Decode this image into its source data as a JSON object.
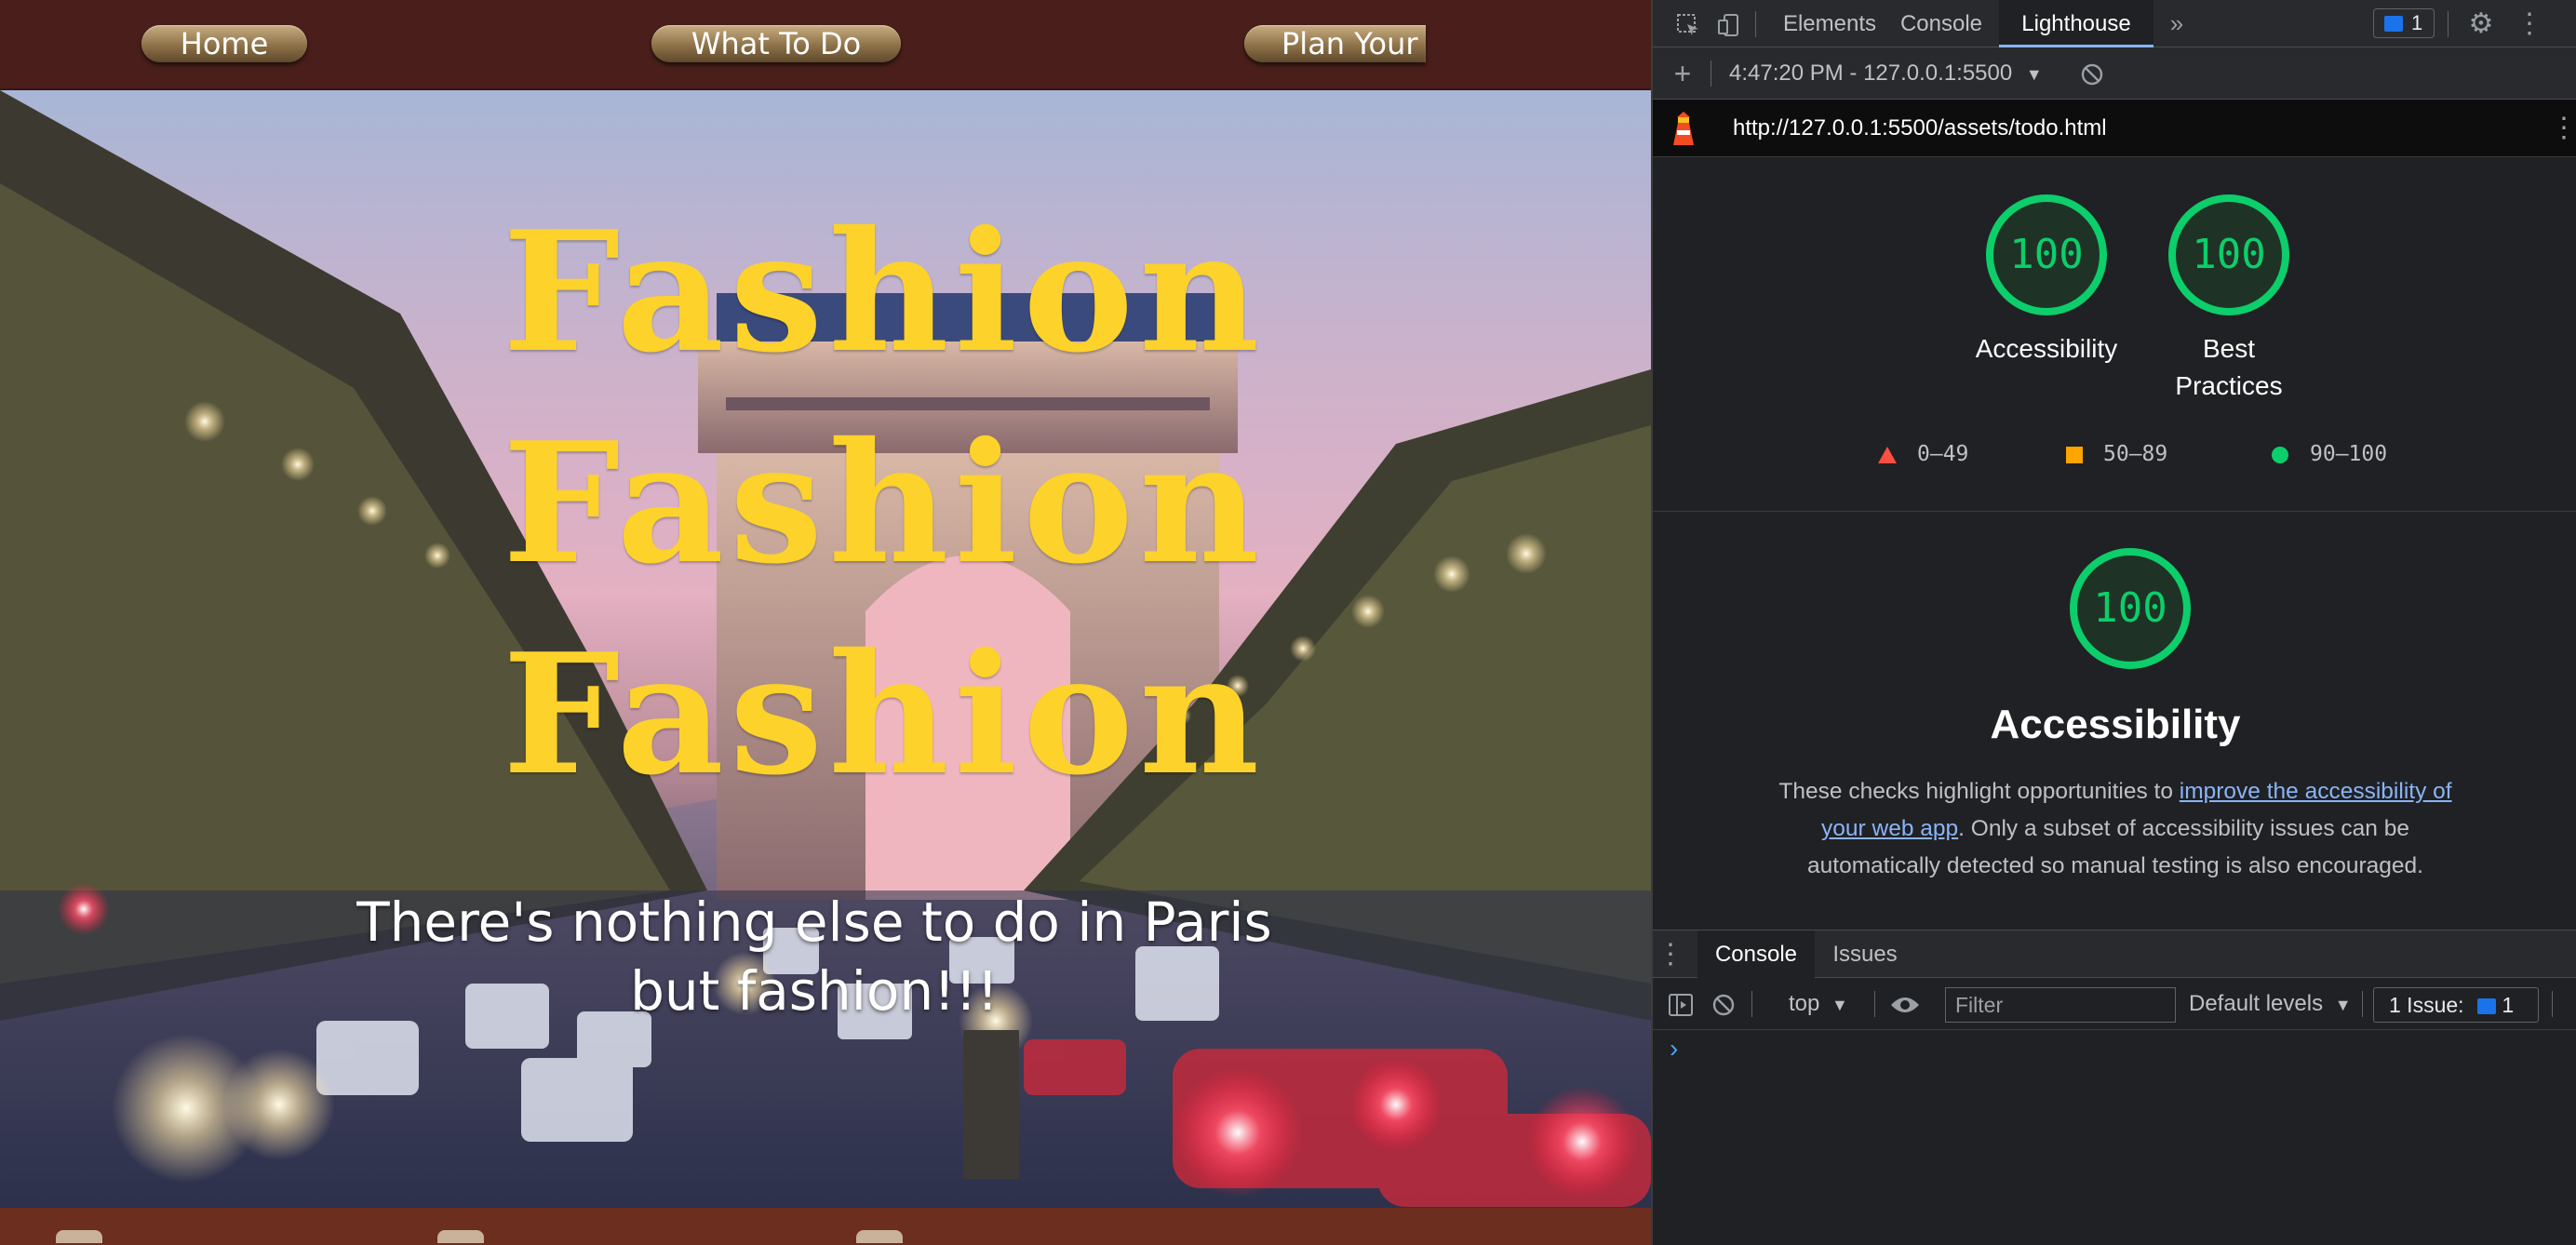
{
  "site": {
    "nav": {
      "home": "Home",
      "what_to_do": "What To Do",
      "plan": "Plan Your"
    },
    "hero": {
      "title_lines": [
        "Fashion",
        "Fashion",
        "Fashion"
      ],
      "tagline": "There's nothing else to do in Paris but fashion!!!"
    }
  },
  "devtools": {
    "tabs": {
      "elements": "Elements",
      "console": "Console",
      "lighthouse": "Lighthouse"
    },
    "issues_count": "1",
    "report_selector": "4:47:20 PM - 127.0.0.1:5500",
    "url": "http://127.0.0.1:5500/assets/todo.html",
    "scores": [
      {
        "value": "100",
        "label": "Accessibility"
      },
      {
        "value": "100",
        "label": "Best Practices"
      }
    ],
    "legend": [
      {
        "range": "0–49",
        "color": "#ff4e42"
      },
      {
        "range": "50–89",
        "color": "#ffa400"
      },
      {
        "range": "90–100",
        "color": "#0cce6b"
      }
    ],
    "category": {
      "score": "100",
      "title": "Accessibility",
      "desc_before": "These checks highlight opportunities to ",
      "desc_link": "improve the accessibility of your web app",
      "desc_after": ". Only a subset of accessibility issues can be automatically detected so manual testing is also encouraged."
    },
    "drawer": {
      "tabs": {
        "console": "Console",
        "issues": "Issues"
      },
      "context": "top",
      "filter_placeholder": "Filter",
      "levels": "Default levels",
      "issues_label": "1 Issue:",
      "issues_count": "1",
      "prompt": "›"
    }
  }
}
